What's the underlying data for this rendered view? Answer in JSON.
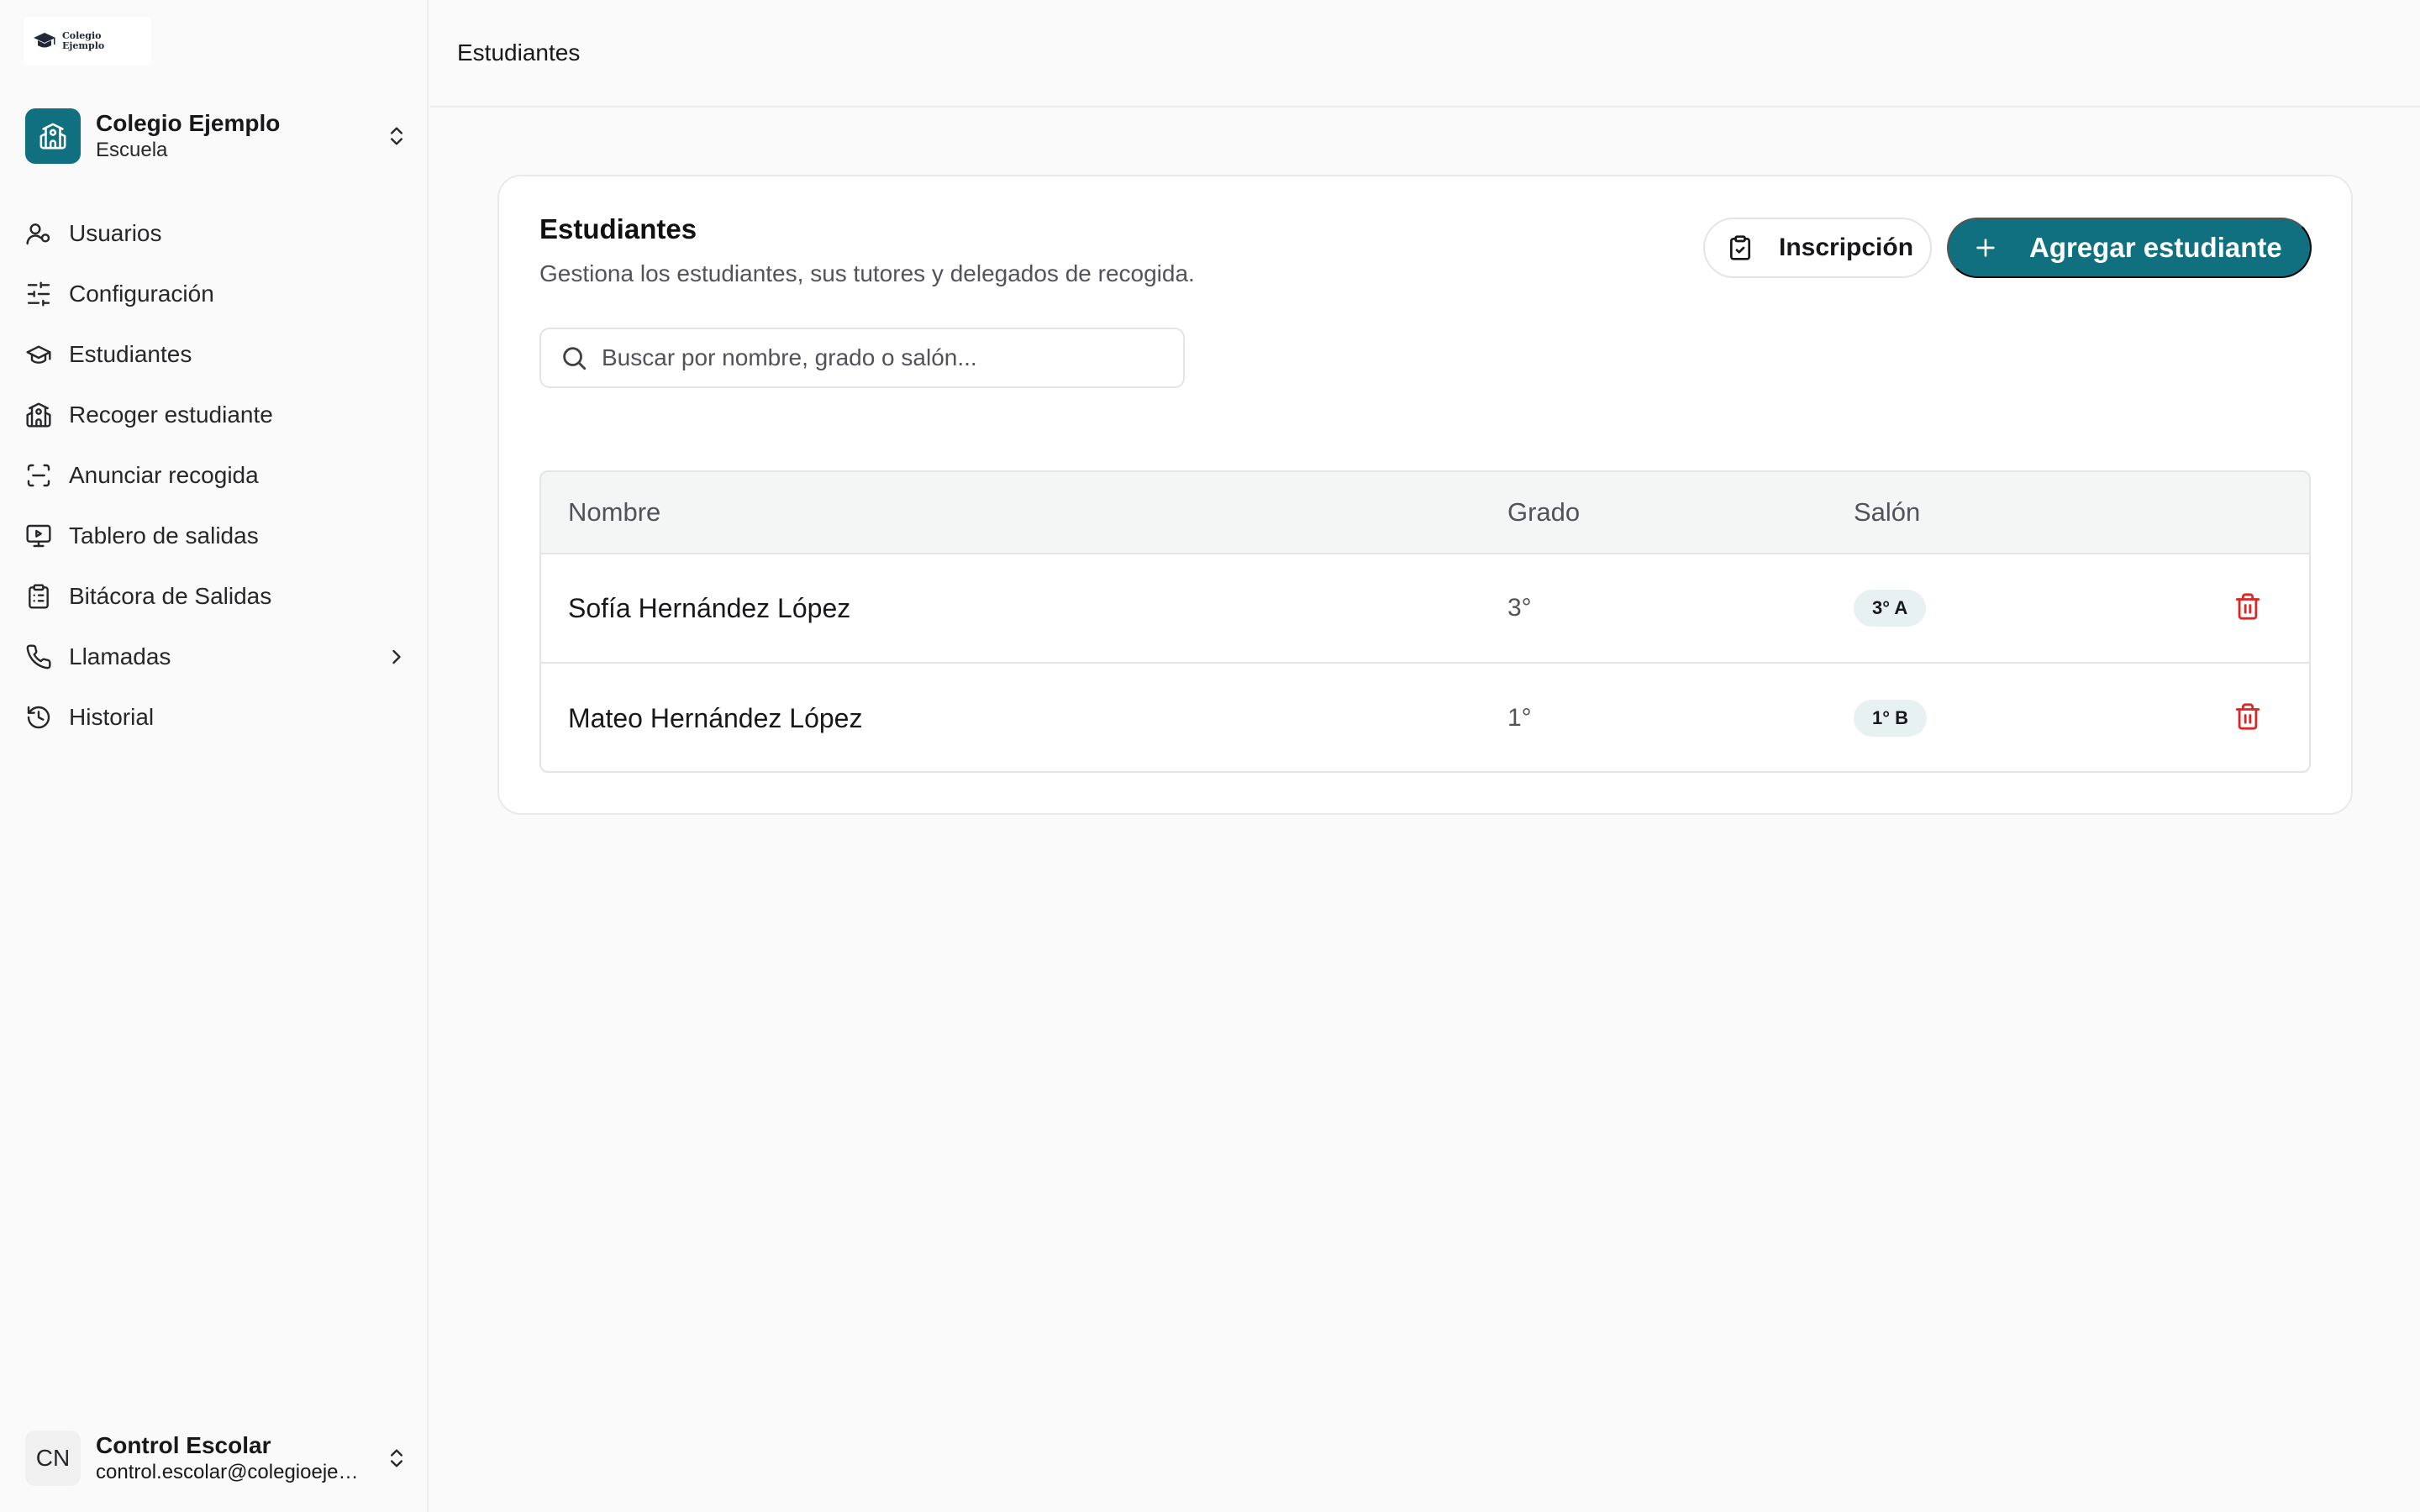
{
  "logo": {
    "line1": "Colegio",
    "line2": "Ejemplo"
  },
  "org": {
    "name": "Colegio Ejemplo",
    "type": "Escuela"
  },
  "nav": [
    {
      "label": "Usuarios",
      "icon": "users-icon"
    },
    {
      "label": "Configuración",
      "icon": "sliders-icon"
    },
    {
      "label": "Estudiantes",
      "icon": "graduation-cap-icon"
    },
    {
      "label": "Recoger estudiante",
      "icon": "school-icon"
    },
    {
      "label": "Anunciar recogida",
      "icon": "scan-icon"
    },
    {
      "label": "Tablero de salidas",
      "icon": "monitor-play-icon"
    },
    {
      "label": "Bitácora de Salidas",
      "icon": "clipboard-list-icon"
    },
    {
      "label": "Llamadas",
      "icon": "phone-icon"
    },
    {
      "label": "Historial",
      "icon": "history-icon"
    }
  ],
  "user": {
    "initials": "CN",
    "name": "Control Escolar",
    "email": "control.escolar@colegioejemplo.edu"
  },
  "topbar": {
    "title": "Estudiantes"
  },
  "card": {
    "title": "Estudiantes",
    "description": "Gestiona los estudiantes, sus tutores y delegados de recogida.",
    "enroll_label": "Inscripción",
    "add_label": "Agregar estudiante"
  },
  "search": {
    "placeholder": "Buscar por nombre, grado o salón..."
  },
  "table": {
    "headers": [
      "Nombre",
      "Grado",
      "Salón"
    ],
    "rows": [
      {
        "nombre": "Sofía Hernández López",
        "grado": "3°",
        "salon": "3° A"
      },
      {
        "nombre": "Mateo Hernández López",
        "grado": "1°",
        "salon": "1° B"
      }
    ]
  },
  "colors": {
    "primary": "#11707f",
    "danger": "#dc2626",
    "badge_bg": "#e8f1f1"
  }
}
